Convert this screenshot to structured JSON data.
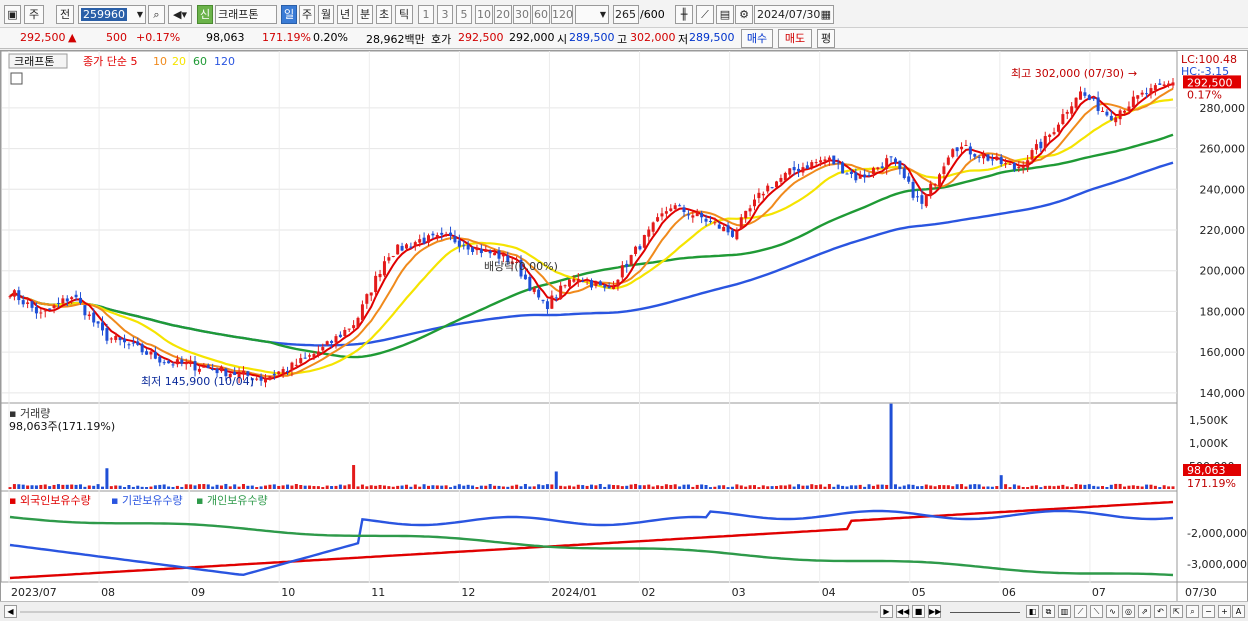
{
  "toolbar": {
    "period_label": "주",
    "prev_label": "전",
    "code": "259960",
    "sin_badge": "신",
    "stock_name": "크래프톤",
    "interval_tabs": [
      "일",
      "주",
      "월",
      "년",
      "분",
      "초",
      "틱"
    ],
    "active_interval": "일",
    "minute_steps": [
      "1",
      "3",
      "5",
      "10",
      "20",
      "30",
      "60",
      "120"
    ],
    "count": "265",
    "count_max": "/600",
    "date": "2024/07/30"
  },
  "quote": {
    "price": "292,500",
    "change": "500",
    "change_pct": "+0.17%",
    "volume": "98,063",
    "volume_ratio": "171.19%",
    "turnover_ratio": "0.20%",
    "amount": "28,962백만",
    "hoga_label": "호가",
    "hoga_ask": "292,500",
    "hoga_bid": "292,000",
    "open_label": "시",
    "open": "289,500",
    "high_label": "고",
    "high": "302,000",
    "low_label": "저",
    "low": "289,500",
    "buy_button": "매수",
    "sell_button": "매도",
    "eval_button": "평"
  },
  "colors": {
    "up": "#e31b1b",
    "down": "#1f4fd6",
    "ma5": "#e00000",
    "ma10": "#f08a1c",
    "ma20": "#f5e400",
    "ma60": "#1f9a35",
    "ma120": "#2a55e0",
    "foreign": "#e00000",
    "institution": "#2a55e0",
    "individual": "#2e9a4a"
  },
  "chart_data": [
    {
      "type": "candlestick",
      "title": "크래프톤",
      "legend": [
        "종가 단순 5",
        "10",
        "20",
        "60",
        "120"
      ],
      "x_tick_labels": [
        "2023/07",
        "08",
        "09",
        "10",
        "11",
        "12",
        "2024/01",
        "02",
        "03",
        "04",
        "05",
        "06",
        "07"
      ],
      "y_ticks": [
        "280,000",
        "260,000",
        "240,000",
        "220,000",
        "200,000",
        "180,000",
        "160,000",
        "140,000"
      ],
      "ylim": [
        136000,
        304000
      ],
      "right_labels": {
        "lc": "LC:100.48",
        "hc": "HC:-3.15",
        "current": "292,500",
        "current_pct": "0.17%"
      },
      "annotations": {
        "high": "최고 302,000 (07/30)",
        "low": "최저 145,900 (10/04)",
        "dividend": "배당락(0.00%)"
      },
      "close_anchors": [
        [
          "2023/07",
          190000
        ],
        [
          "2023/07 mid",
          178000
        ],
        [
          "08 start",
          188000
        ],
        [
          "08 mid",
          168000
        ],
        [
          "08 end",
          162000
        ],
        [
          "09 start",
          155000
        ],
        [
          "09 mid",
          153000
        ],
        [
          "09 end",
          150000
        ],
        [
          "10/04",
          147000
        ],
        [
          "10 mid",
          153000
        ],
        [
          "10 end",
          162000
        ],
        [
          "11 start",
          175000
        ],
        [
          "11 mid",
          208000
        ],
        [
          "11 end",
          215000
        ],
        [
          "12 start",
          216000
        ],
        [
          "12 mid",
          210000
        ],
        [
          "12 end",
          205000
        ],
        [
          "2024/01 start",
          182000
        ],
        [
          "01 mid",
          198000
        ],
        [
          "01 end",
          190000
        ],
        [
          "02 start",
          212000
        ],
        [
          "02 mid",
          232000
        ],
        [
          "02 end",
          226000
        ],
        [
          "03 start",
          218000
        ],
        [
          "03 mid",
          240000
        ],
        [
          "03 end",
          250000
        ],
        [
          "04 start",
          255000
        ],
        [
          "04 mid",
          245000
        ],
        [
          "04 end",
          255000
        ],
        [
          "05 start",
          232000
        ],
        [
          "05 mid",
          262000
        ],
        [
          "05 end",
          256000
        ],
        [
          "06 start",
          250000
        ],
        [
          "06 mid",
          265000
        ],
        [
          "06 end",
          288000
        ],
        [
          "07 start",
          276000
        ],
        [
          "07 mid",
          286000
        ],
        [
          "07/30",
          292500
        ]
      ]
    },
    {
      "type": "bar",
      "title": "거래량",
      "current_label": "98,063주(171.19%)",
      "y_ticks": [
        "1,500K",
        "1,000K",
        "500,000"
      ],
      "ylim": [
        0,
        1800000
      ],
      "right_labels": {
        "current": "98,063",
        "current_pct": "171.19%"
      },
      "spikes": [
        [
          "08 start",
          450000
        ],
        [
          "10 end",
          520000
        ],
        [
          "2024/01 start",
          380000
        ],
        [
          "04 end",
          1850000
        ],
        [
          "06 start",
          300000
        ]
      ]
    },
    {
      "type": "line",
      "series": [
        {
          "name": "외국인보유수량"
        },
        {
          "name": "기관보유수량"
        },
        {
          "name": "개인보유수량"
        }
      ],
      "y_ticks": [
        "-2,000,000",
        "-3,000,000"
      ],
      "end_label": "07/30"
    }
  ]
}
